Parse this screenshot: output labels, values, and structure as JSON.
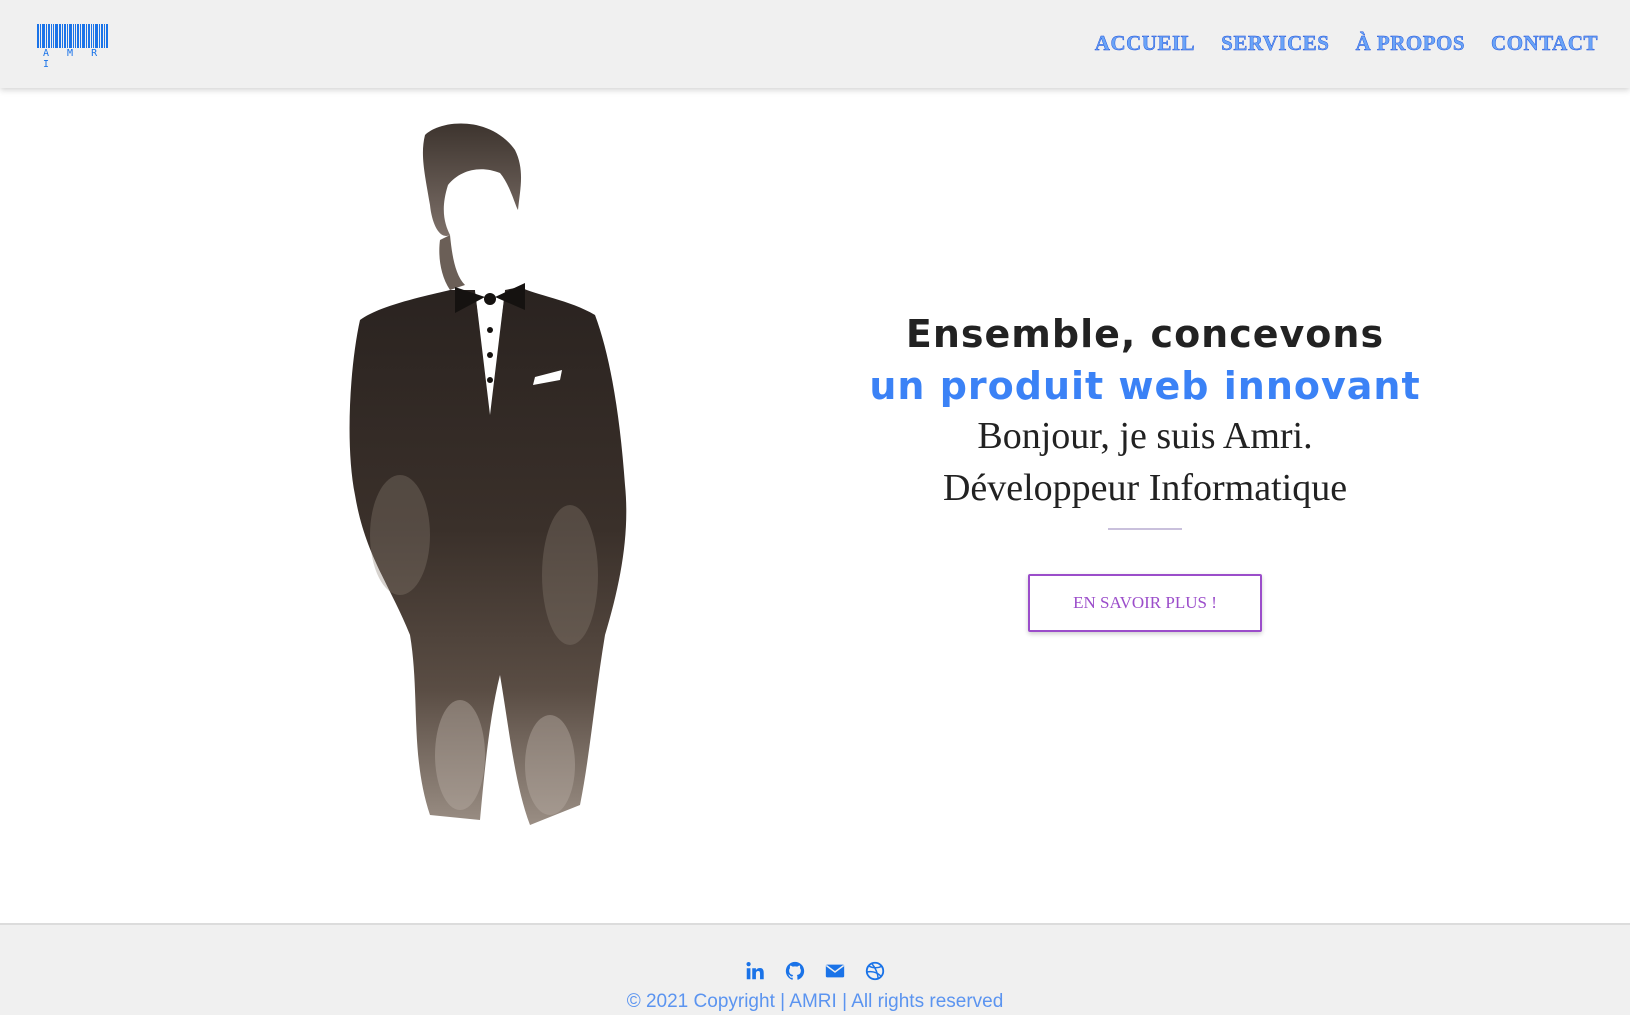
{
  "header": {
    "logo_text": "A M R I",
    "nav": [
      {
        "label": "ACCUEIL"
      },
      {
        "label": "SERVICES"
      },
      {
        "label": "À PROPOS"
      },
      {
        "label": "CONTACT"
      }
    ]
  },
  "hero": {
    "line1": "Ensemble, concevons",
    "line2": "un produit web innovant",
    "line3": "Bonjour, je suis Amri.",
    "line4": "Développeur Informatique",
    "cta_label": "EN SAVOIR PLUS !"
  },
  "footer": {
    "social_icons": [
      "linkedin-icon",
      "github-icon",
      "envelope-icon",
      "dribbble-icon"
    ],
    "copyright": "© 2021 Copyright | AMRI | All rights reserved"
  },
  "colors": {
    "accent_blue": "#3b82f6",
    "button_purple": "#9b4dca",
    "text_dark": "#222222",
    "header_bg": "#f0f0f0"
  }
}
